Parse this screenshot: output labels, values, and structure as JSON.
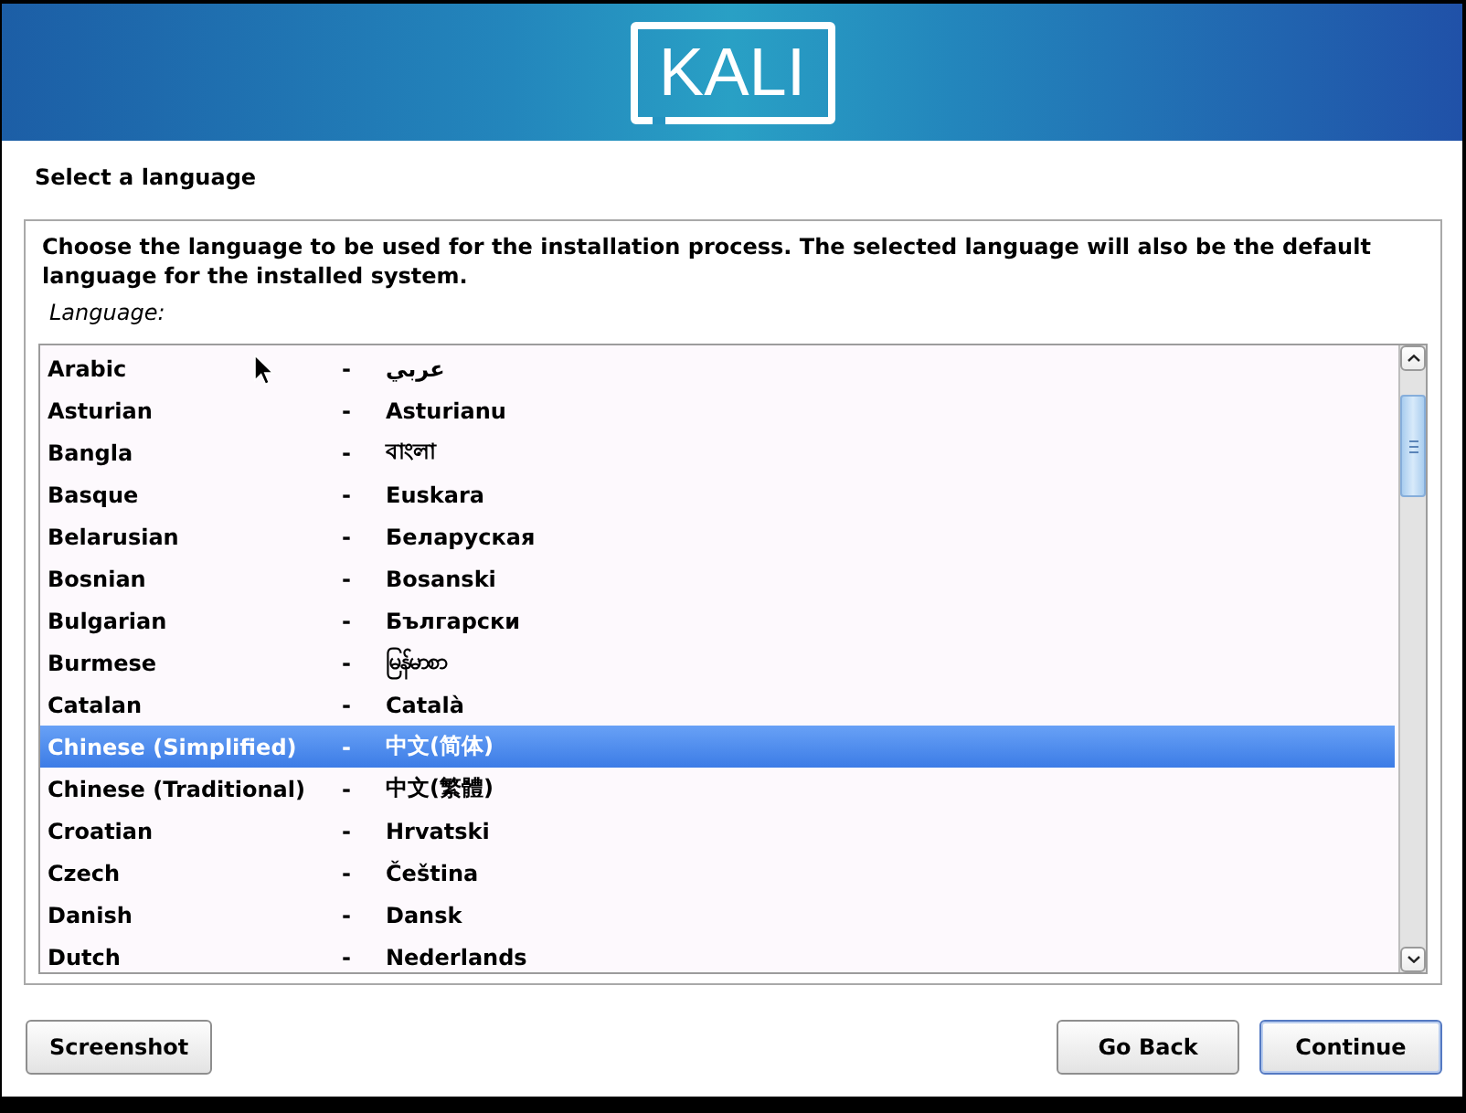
{
  "header": {
    "logo": "KALI"
  },
  "title": "Select a language",
  "panel": {
    "description": "Choose the language to be used for the installation process. The selected language will also be the default language for the installed system.",
    "list_label": "Language:",
    "languages": [
      {
        "name": "Arabic",
        "separator": "-",
        "native": "عربي",
        "selected": false
      },
      {
        "name": "Asturian",
        "separator": "-",
        "native": "Asturianu",
        "selected": false
      },
      {
        "name": "Bangla",
        "separator": "-",
        "native": "বাংলা",
        "selected": false
      },
      {
        "name": "Basque",
        "separator": "-",
        "native": "Euskara",
        "selected": false
      },
      {
        "name": "Belarusian",
        "separator": "-",
        "native": "Беларуская",
        "selected": false
      },
      {
        "name": "Bosnian",
        "separator": "-",
        "native": "Bosanski",
        "selected": false
      },
      {
        "name": "Bulgarian",
        "separator": "-",
        "native": "Български",
        "selected": false
      },
      {
        "name": "Burmese",
        "separator": "-",
        "native": "မြန်မာစာ",
        "selected": false
      },
      {
        "name": "Catalan",
        "separator": "-",
        "native": "Català",
        "selected": false
      },
      {
        "name": "Chinese (Simplified)",
        "separator": "-",
        "native": "中文(简体)",
        "selected": true
      },
      {
        "name": "Chinese (Traditional)",
        "separator": "-",
        "native": "中文(繁體)",
        "selected": false
      },
      {
        "name": "Croatian",
        "separator": "-",
        "native": "Hrvatski",
        "selected": false
      },
      {
        "name": "Czech",
        "separator": "-",
        "native": "Čeština",
        "selected": false
      },
      {
        "name": "Danish",
        "separator": "-",
        "native": "Dansk",
        "selected": false
      },
      {
        "name": "Dutch",
        "separator": "-",
        "native": "Nederlands",
        "selected": false
      }
    ]
  },
  "footer": {
    "left_buttons": [
      {
        "label": "Screenshot",
        "focused": false
      }
    ],
    "right_buttons": [
      {
        "label": "Go Back",
        "focused": false
      },
      {
        "label": "Continue",
        "focused": true
      }
    ]
  }
}
